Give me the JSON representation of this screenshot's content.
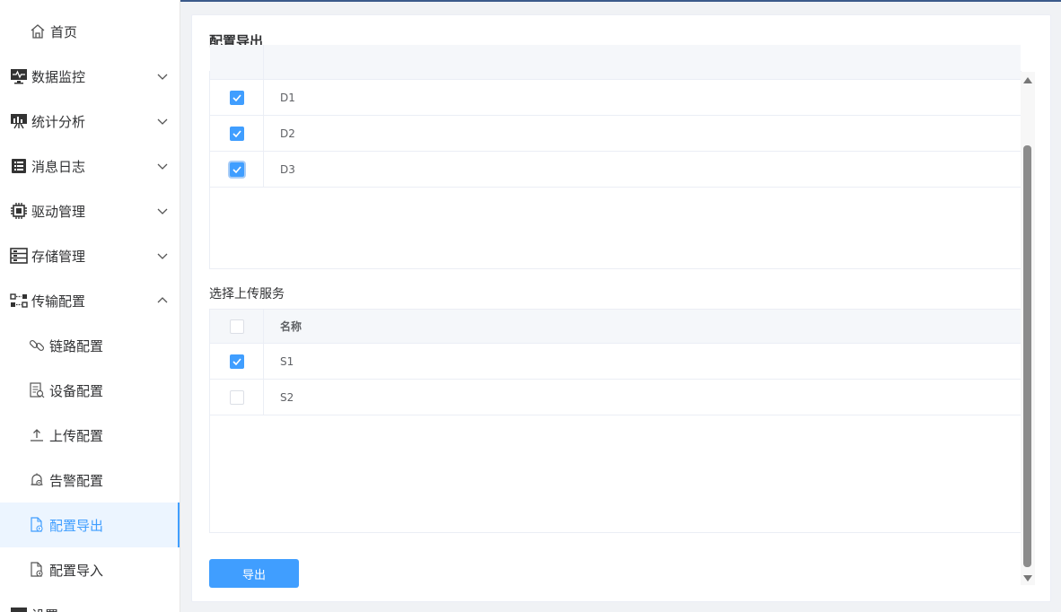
{
  "sidebar": {
    "home": "首页",
    "items": [
      {
        "label": "数据监控",
        "icon": "monitor-icon"
      },
      {
        "label": "统计分析",
        "icon": "chart-icon"
      },
      {
        "label": "消息日志",
        "icon": "log-icon"
      },
      {
        "label": "驱动管理",
        "icon": "chip-icon"
      },
      {
        "label": "存储管理",
        "icon": "storage-icon"
      },
      {
        "label": "传输配置",
        "icon": "transfer-icon"
      }
    ],
    "sub_items": [
      {
        "label": "链路配置",
        "icon": "link-icon"
      },
      {
        "label": "设备配置",
        "icon": "device-icon"
      },
      {
        "label": "上传配置",
        "icon": "upload-icon"
      },
      {
        "label": "告警配置",
        "icon": "alarm-icon"
      },
      {
        "label": "配置导出",
        "icon": "export-file-icon",
        "active": true
      },
      {
        "label": "配置导入",
        "icon": "import-file-icon"
      }
    ],
    "partial_next": "设置",
    "active_color": "#409eff"
  },
  "main": {
    "title": "配置导出",
    "device_table": {
      "rows": [
        {
          "name": "D1",
          "checked": true
        },
        {
          "name": "D2",
          "checked": true
        },
        {
          "name": "D3",
          "checked": true
        }
      ]
    },
    "service_section_label": "选择上传服务",
    "service_table": {
      "header": "名称",
      "rows": [
        {
          "name": "S1",
          "checked": true
        },
        {
          "name": "S2",
          "checked": false
        }
      ]
    },
    "export_button": "导出"
  }
}
